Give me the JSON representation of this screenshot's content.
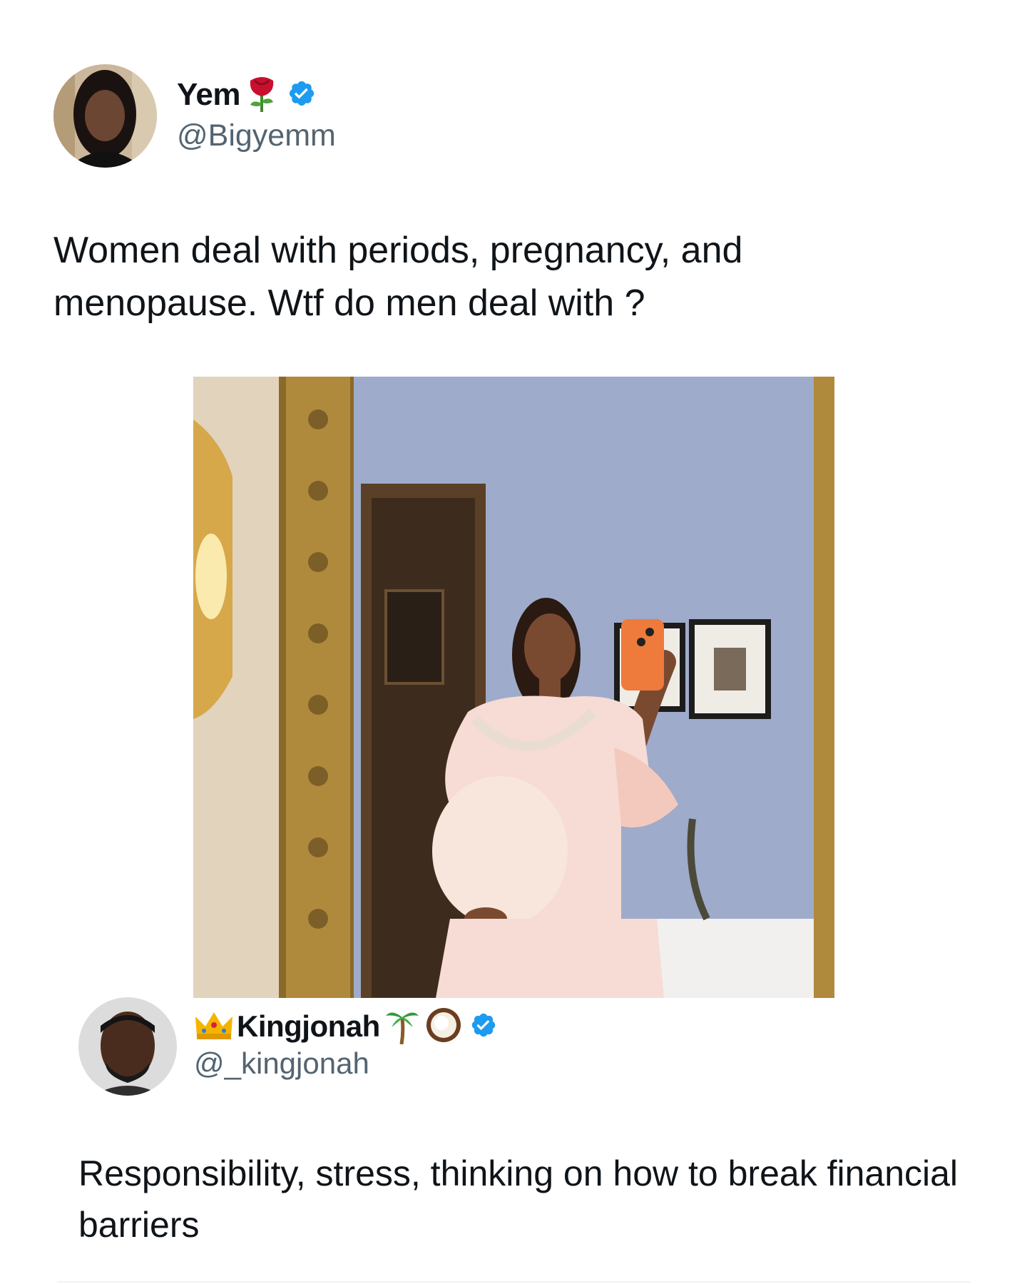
{
  "tweet": {
    "author": {
      "display_name": "Yem",
      "name_emoji": "rose-emoji",
      "verified": true,
      "handle": "@Bigyemm"
    },
    "text": "Women deal with periods, pregnancy, and menopause. Wtf do men deal with ?",
    "media": {
      "type": "photo"
    }
  },
  "reply": {
    "author": {
      "display_name": "Kingjonah",
      "name_emojis": [
        "crown-emoji",
        "palm-tree-emoji",
        "coconut-emoji"
      ],
      "verified": true,
      "handle": "@_kingjonah"
    },
    "text": "Responsibility, stress, thinking on how to break financial barriers"
  },
  "colors": {
    "text": "#0f1419",
    "secondary_text": "#536471",
    "verified_badge": "#1d9bf0",
    "background": "#ffffff"
  }
}
